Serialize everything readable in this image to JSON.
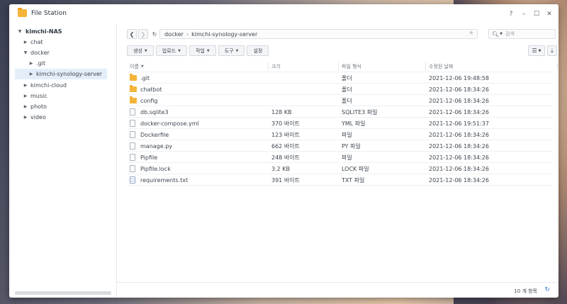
{
  "window": {
    "title": "File Station",
    "controls": [
      "?",
      "–",
      "☐",
      "✕"
    ]
  },
  "sidebar": {
    "root": "kimchi-NAS",
    "items": [
      {
        "label": "chat",
        "expanded": false
      },
      {
        "label": "docker",
        "expanded": true
      },
      {
        "label": ".git",
        "expanded": false
      },
      {
        "label": "kimchi-synology-server",
        "expanded": false,
        "selected": true
      },
      {
        "label": "kimchi-cloud",
        "expanded": false
      },
      {
        "label": "music",
        "expanded": false
      },
      {
        "label": "photo",
        "expanded": false
      },
      {
        "label": "video",
        "expanded": false
      }
    ]
  },
  "path": {
    "segments": [
      "docker",
      "kimchi-synology-server"
    ],
    "separator": "›"
  },
  "search": {
    "placeholder": "검색"
  },
  "toolbar": {
    "create": "생성",
    "upload": "업로드",
    "action": "작업",
    "tools": "도구",
    "settings": "설정"
  },
  "columns": {
    "name": "이름",
    "size": "크기",
    "type": "파일 형식",
    "modified": "수정된 날짜"
  },
  "files": [
    {
      "name": ".git",
      "size": "",
      "type": "폴더",
      "modified": "2021-12-06 19:48:58",
      "icon": "folder-icon"
    },
    {
      "name": "chatbot",
      "size": "",
      "type": "폴더",
      "modified": "2021-12-06 18:34:26",
      "icon": "folder-icon"
    },
    {
      "name": "config",
      "size": "",
      "type": "폴더",
      "modified": "2021-12-06 18:34:26",
      "icon": "folder-icon"
    },
    {
      "name": "db.sqlite3",
      "size": "128 KB",
      "type": "SQLITE3 파일",
      "modified": "2021-12-06 18:34:26",
      "icon": "file-icon"
    },
    {
      "name": "docker-compose.yml",
      "size": "370 바이트",
      "type": "YML 파일",
      "modified": "2021-12-06 19:51:37",
      "icon": "file-icon"
    },
    {
      "name": "Dockerfile",
      "size": "123 바이트",
      "type": "파일",
      "modified": "2021-12-06 18:34:26",
      "icon": "file-icon"
    },
    {
      "name": "manage.py",
      "size": "662 바이트",
      "type": "PY 파일",
      "modified": "2021-12-06 18:34:26",
      "icon": "file-icon"
    },
    {
      "name": "Pipfile",
      "size": "248 바이트",
      "type": "파일",
      "modified": "2021-12-06 18:34:26",
      "icon": "file-icon"
    },
    {
      "name": "Pipfile.lock",
      "size": "3.2 KB",
      "type": "LOCK 파일",
      "modified": "2021-12-06 18:34:26",
      "icon": "file-icon"
    },
    {
      "name": "requirements.txt",
      "size": "391 바이트",
      "type": "TXT 파일",
      "modified": "2021-12-06 18:34:26",
      "icon": "txt-icon"
    }
  ],
  "footer": {
    "count": "10 개 항목"
  },
  "colors": {
    "folder": "#f5b43a",
    "accent": "#2f7bd6",
    "selected_bg": "#e4eefb"
  }
}
